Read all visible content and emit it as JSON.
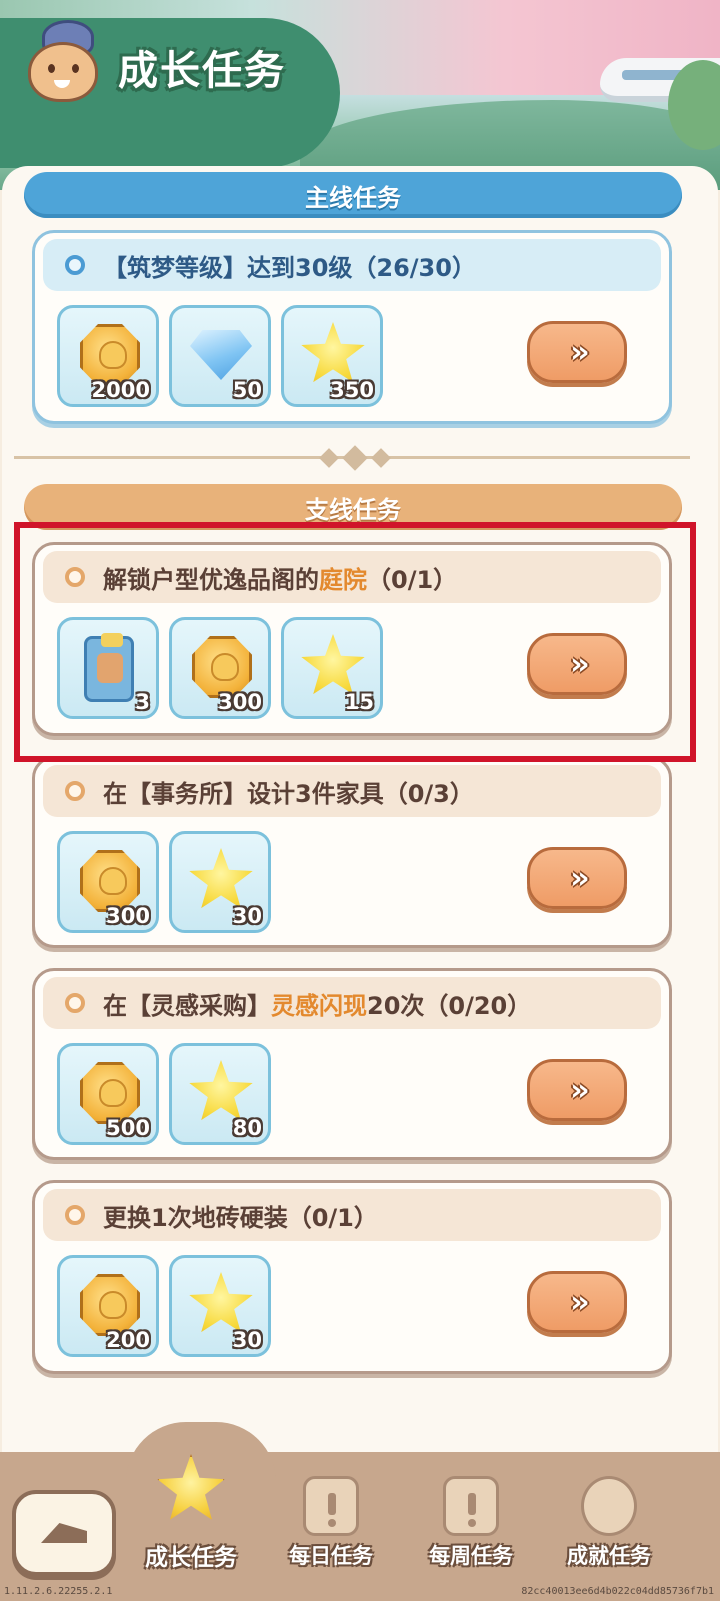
{
  "header": {
    "title": "成长任务"
  },
  "sections": {
    "main_title": "主线任务",
    "side_title": "支线任务"
  },
  "main_task": {
    "title": "【筑梦等级】达到30级（26/30）",
    "rewards": [
      {
        "icon": "coin-icon",
        "count": "2000"
      },
      {
        "icon": "diamond-icon",
        "count": "50"
      },
      {
        "icon": "star-icon",
        "count": "350"
      }
    ],
    "go_label": "»"
  },
  "side_tasks": [
    {
      "title_pre": "解锁户型优逸品阁的",
      "title_highlight": "庭院",
      "title_post": "（0/1）",
      "rewards": [
        {
          "icon": "blueprint-book-icon",
          "count": "3"
        },
        {
          "icon": "coin-icon",
          "count": "300"
        },
        {
          "icon": "star-icon",
          "count": "15"
        }
      ]
    },
    {
      "title_pre": "在【事务所】设计3件家具（0/3）",
      "title_highlight": "",
      "title_post": "",
      "rewards": [
        {
          "icon": "coin-icon",
          "count": "300"
        },
        {
          "icon": "star-icon",
          "count": "30"
        }
      ]
    },
    {
      "title_pre": "在【灵感采购】",
      "title_highlight": "灵感闪现",
      "title_post": "20次（0/20）",
      "rewards": [
        {
          "icon": "coin-icon",
          "count": "500"
        },
        {
          "icon": "star-icon",
          "count": "80"
        }
      ]
    },
    {
      "title_pre": "更换1次地砖硬装（0/1）",
      "title_highlight": "",
      "title_post": "",
      "rewards": [
        {
          "icon": "coin-icon",
          "count": "200"
        },
        {
          "icon": "star-icon",
          "count": "30"
        }
      ]
    }
  ],
  "go_label": "»",
  "nav": {
    "back_icon": "back-arrow-icon",
    "tabs": [
      {
        "label": "成长任务",
        "icon": "star-icon",
        "active": true
      },
      {
        "label": "每日任务",
        "icon": "daily-calendar-icon",
        "active": false
      },
      {
        "label": "每周任务",
        "icon": "weekly-notebook-icon",
        "active": false
      },
      {
        "label": "成就任务",
        "icon": "trophy-medal-icon",
        "active": false
      }
    ]
  },
  "footer": {
    "version": "1.11.2.6.22255.2.1",
    "build_hash": "82cc40013ee6d4b022c04dd85736f7b1"
  },
  "colors": {
    "highlight_text": "#e3892e",
    "main_section": "#4ea4d8",
    "side_section": "#e8b27a",
    "selection_box": "#d0142a"
  }
}
